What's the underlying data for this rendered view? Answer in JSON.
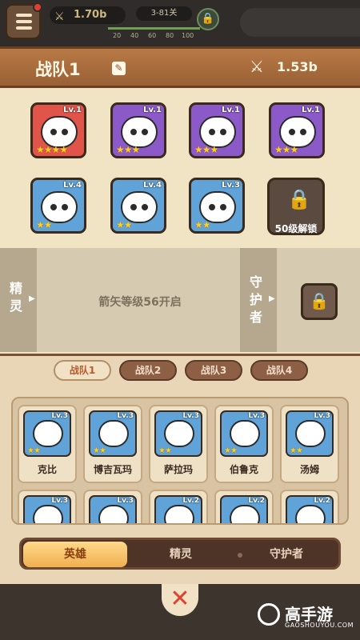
{
  "hud": {
    "power": "1.70b",
    "stage": "3-81关",
    "progress_ticks": [
      "20",
      "40",
      "60",
      "80",
      "100"
    ]
  },
  "team": {
    "title": "战队1",
    "power": "1.53b",
    "heroes": [
      {
        "level": "Lv.1",
        "stars": "★★★★",
        "color": "#e0544a"
      },
      {
        "level": "Lv.1",
        "stars": "★★★",
        "color": "#8c5ac8"
      },
      {
        "level": "Lv.1",
        "stars": "★★★",
        "color": "#8c5ac8"
      },
      {
        "level": "Lv.1",
        "stars": "★★★",
        "color": "#8c5ac8"
      },
      {
        "level": "Lv.4",
        "stars": "★★",
        "color": "#5fa3d8"
      },
      {
        "level": "Lv.4",
        "stars": "★★",
        "color": "#5fa3d8"
      },
      {
        "level": "Lv.3",
        "stars": "★★",
        "color": "#5fa3d8"
      }
    ],
    "locked_slot_text": "50级解锁"
  },
  "strip": {
    "spirit_label": "精灵",
    "spirit_text": "箭矢等级56开启",
    "guardian_label": "守护者"
  },
  "team_tabs": [
    "战队1",
    "战队2",
    "战队3",
    "战队4"
  ],
  "roster": [
    {
      "name": "克比",
      "level": "Lv.3",
      "stars": "★★"
    },
    {
      "name": "博吉瓦玛",
      "level": "Lv.3",
      "stars": "★★"
    },
    {
      "name": "萨拉玛",
      "level": "Lv.3",
      "stars": "★★"
    },
    {
      "name": "伯鲁克",
      "level": "Lv.3",
      "stars": "★★"
    },
    {
      "name": "汤姆",
      "level": "Lv.3",
      "stars": "★★"
    },
    {
      "name": "",
      "level": "Lv.3",
      "stars": ""
    },
    {
      "name": "",
      "level": "Lv.3",
      "stars": ""
    },
    {
      "name": "",
      "level": "Lv.2",
      "stars": ""
    },
    {
      "name": "",
      "level": "Lv.2",
      "stars": ""
    },
    {
      "name": "",
      "level": "Lv.2",
      "stars": ""
    }
  ],
  "segments": [
    "英雄",
    "精灵",
    "守护者"
  ],
  "close": "✕",
  "watermark": {
    "text": "高手游",
    "sub": "GAOSHOUYOU.COM"
  }
}
